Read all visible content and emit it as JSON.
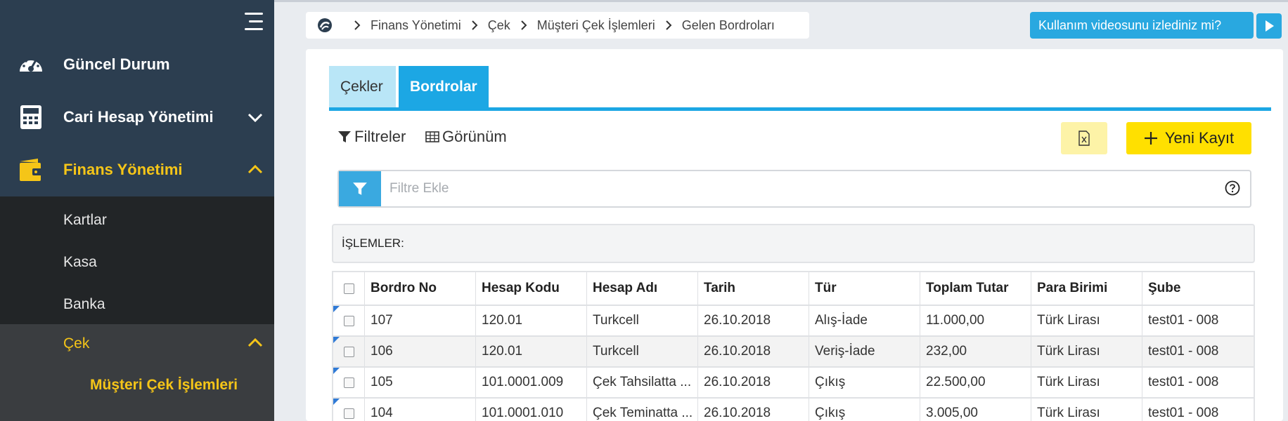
{
  "sidebar": {
    "items": [
      {
        "label": "Güncel Durum"
      },
      {
        "label": "Cari Hesap Yönetimi"
      },
      {
        "label": "Finans Yönetimi"
      }
    ],
    "finans_sub": [
      {
        "label": "Kartlar"
      },
      {
        "label": "Kasa"
      },
      {
        "label": "Banka"
      }
    ],
    "cek": {
      "label": "Çek",
      "sub": "Müşteri Çek İşlemleri"
    },
    "accent": "#f5c518"
  },
  "breadcrumb": [
    "Finans Yönetimi",
    "Çek",
    "Müşteri Çek İşlemleri",
    "Gelen Bordroları"
  ],
  "help_banner": "Kullanım videosunu izlediniz mi?",
  "tabs": [
    {
      "label": "Çekler"
    },
    {
      "label": "Bordrolar"
    }
  ],
  "toolbar": {
    "filters": "Filtreler",
    "view": "Görünüm",
    "new_record": "Yeni Kayıt"
  },
  "filter": {
    "placeholder": "Filtre Ekle"
  },
  "ops_label": "İŞLEMLER:",
  "table": {
    "columns": [
      "Bordro No",
      "Hesap Kodu",
      "Hesap Adı",
      "Tarih",
      "Tür",
      "Toplam Tutar",
      "Para Birimi",
      "Şube"
    ],
    "rows": [
      [
        "107",
        "120.01",
        "Turkcell",
        "26.10.2018",
        "Alış-İade",
        "11.000,00",
        "Türk Lirası",
        "test01 - 008"
      ],
      [
        "106",
        "120.01",
        "Turkcell",
        "26.10.2018",
        "Veriş-İade",
        "232,00",
        "Türk Lirası",
        "test01 - 008"
      ],
      [
        "105",
        "101.0001.009",
        "Çek Tahsilatta ...",
        "26.10.2018",
        "Çıkış",
        "22.500,00",
        "Türk Lirası",
        "test01 - 008"
      ],
      [
        "104",
        "101.0001.010",
        "Çek Teminatta ...",
        "26.10.2018",
        "Çıkış",
        "3.005,00",
        "Türk Lirası",
        "test01 - 008"
      ]
    ]
  }
}
